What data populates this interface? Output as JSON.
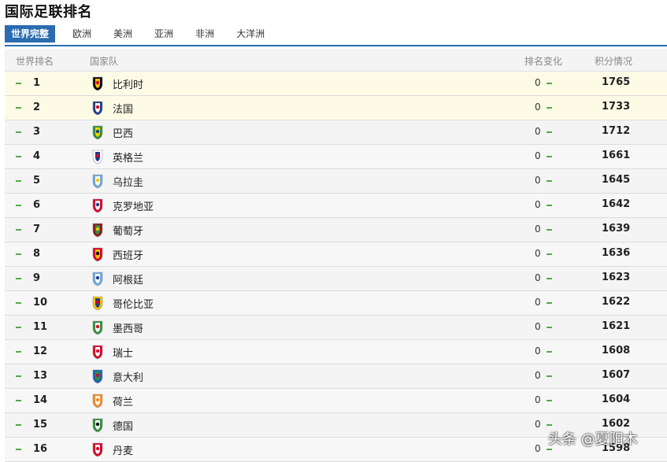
{
  "page_title": "国际足联排名",
  "tabs": [
    "世界完整",
    "欧洲",
    "美洲",
    "亚洲",
    "非洲",
    "大洋洲"
  ],
  "active_tab": 0,
  "headers": {
    "rank": "世界排名",
    "team": "国家队",
    "change": "排名变化",
    "points": "积分情况"
  },
  "rows": [
    {
      "rank": "1",
      "team": "比利时",
      "change": "0",
      "points": "1765",
      "flag": "belgium-flag-icon",
      "colors": [
        "#000000",
        "#f4c300",
        "#d80027"
      ]
    },
    {
      "rank": "2",
      "team": "法国",
      "change": "0",
      "points": "1733",
      "flag": "france-flag-icon",
      "colors": [
        "#1a3e8c",
        "#ffffff",
        "#d80027"
      ]
    },
    {
      "rank": "3",
      "team": "巴西",
      "change": "0",
      "points": "1712",
      "flag": "brazil-flag-icon",
      "colors": [
        "#2f8f3a",
        "#f4d400",
        "#1a3e8c"
      ]
    },
    {
      "rank": "4",
      "team": "英格兰",
      "change": "0",
      "points": "1661",
      "flag": "england-flag-icon",
      "colors": [
        "#ffffff",
        "#1a3e8c",
        "#d80027"
      ]
    },
    {
      "rank": "5",
      "team": "乌拉圭",
      "change": "0",
      "points": "1645",
      "flag": "uruguay-flag-icon",
      "colors": [
        "#6fa8dc",
        "#ffffff",
        "#f4c300"
      ]
    },
    {
      "rank": "6",
      "team": "克罗地亚",
      "change": "0",
      "points": "1642",
      "flag": "croatia-flag-icon",
      "colors": [
        "#d80027",
        "#ffffff",
        "#1a3e8c"
      ]
    },
    {
      "rank": "7",
      "team": "葡萄牙",
      "change": "0",
      "points": "1639",
      "flag": "portugal-flag-icon",
      "colors": [
        "#8b1a1a",
        "#2f8f3a",
        "#f4c300"
      ]
    },
    {
      "rank": "8",
      "team": "西班牙",
      "change": "0",
      "points": "1636",
      "flag": "spain-flag-icon",
      "colors": [
        "#d80027",
        "#f4c300",
        "#000000"
      ]
    },
    {
      "rank": "9",
      "team": "阿根廷",
      "change": "0",
      "points": "1623",
      "flag": "argentina-flag-icon",
      "colors": [
        "#6fa8dc",
        "#ffffff",
        "#1a3e8c"
      ]
    },
    {
      "rank": "10",
      "team": "哥伦比亚",
      "change": "0",
      "points": "1622",
      "flag": "colombia-flag-icon",
      "colors": [
        "#f4c300",
        "#1a3e8c",
        "#d80027"
      ]
    },
    {
      "rank": "11",
      "team": "墨西哥",
      "change": "0",
      "points": "1621",
      "flag": "mexico-flag-icon",
      "colors": [
        "#2f8f3a",
        "#ffffff",
        "#d80027"
      ]
    },
    {
      "rank": "12",
      "team": "瑞士",
      "change": "0",
      "points": "1608",
      "flag": "switzerland-flag-icon",
      "colors": [
        "#d80027",
        "#ffffff",
        "#d80027"
      ]
    },
    {
      "rank": "13",
      "team": "意大利",
      "change": "0",
      "points": "1607",
      "flag": "italy-flag-icon",
      "colors": [
        "#1a5fb4",
        "#2f8f3a",
        "#d80027"
      ]
    },
    {
      "rank": "14",
      "team": "荷兰",
      "change": "0",
      "points": "1604",
      "flag": "netherlands-flag-icon",
      "colors": [
        "#f28c28",
        "#ffffff",
        "#f28c28"
      ]
    },
    {
      "rank": "15",
      "team": "德国",
      "change": "0",
      "points": "1602",
      "flag": "germany-flag-icon",
      "colors": [
        "#2f8f3a",
        "#ffffff",
        "#000000"
      ]
    },
    {
      "rank": "16",
      "team": "丹麦",
      "change": "0",
      "points": "1598",
      "flag": "denmark-flag-icon",
      "colors": [
        "#d80027",
        "#ffffff",
        "#d80027"
      ]
    }
  ],
  "watermark": "头条 @夏阳木",
  "accent": "#2b6cb0",
  "change_mark_color": "#55a84a"
}
